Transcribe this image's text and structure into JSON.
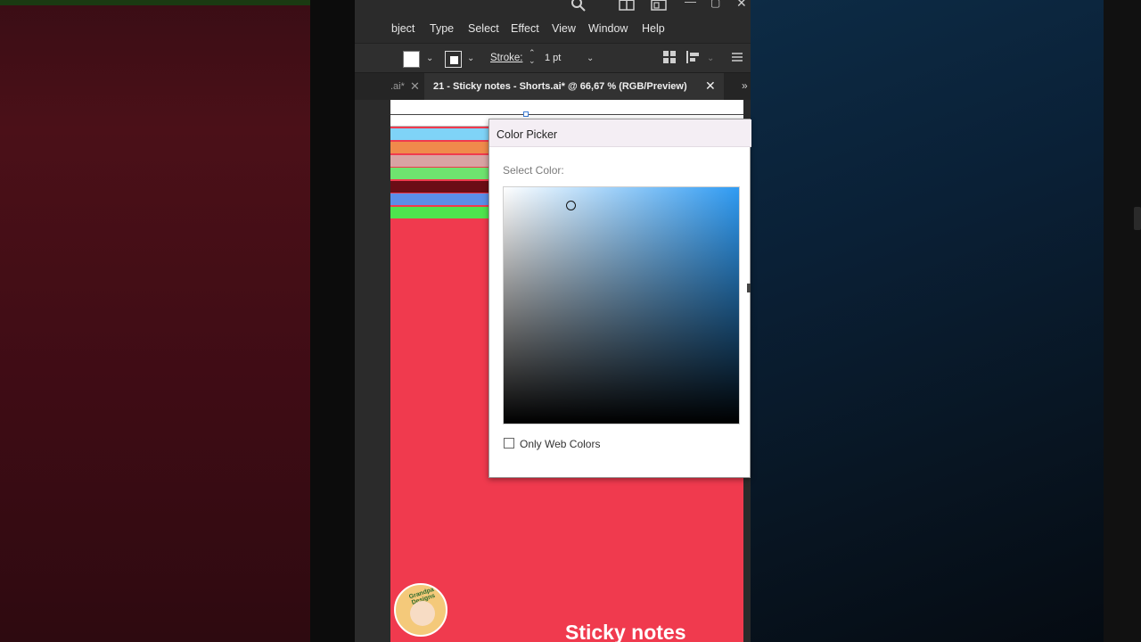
{
  "menu": {
    "items": [
      "Object",
      "Type",
      "Select",
      "Effect",
      "View",
      "Window",
      "Help"
    ],
    "visible_labels": [
      "bject",
      "Type",
      "Select",
      "Effect",
      "View",
      "Window",
      "Help"
    ]
  },
  "control_bar": {
    "stroke_label": "Stroke:",
    "stroke_value": "1 pt",
    "fill_color": "#ffffff"
  },
  "tabs": {
    "previous_label": ".ai*",
    "active_label": "21 - Sticky notes - Shorts.ai* @ 66,67 % (RGB/Preview)"
  },
  "canvas": {
    "background": "#f03a4e",
    "title": "Sticky notes",
    "logo_text": "Grandpa Designs",
    "stripes": [
      {
        "color": "#7fd3f7"
      },
      {
        "color": "#f08a4b"
      },
      {
        "color": "#d9a3a3"
      },
      {
        "color": "#6fe36f"
      },
      {
        "color": "#6b0d16"
      },
      {
        "color": "#5b8ee8"
      },
      {
        "color": "#4ee44e"
      }
    ]
  },
  "color_picker": {
    "title": "Color Picker",
    "select_label": "Select Color:",
    "hue_color": "#2f9bf3",
    "only_web_colors_label": "Only Web Colors",
    "only_web_colors_checked": false
  },
  "icons": {
    "search": "search-icon",
    "workspace": "workspace-icon",
    "arrange": "arrange-documents-icon",
    "minimize": "minimize-icon",
    "maximize": "maximize-icon",
    "close": "close-icon"
  }
}
